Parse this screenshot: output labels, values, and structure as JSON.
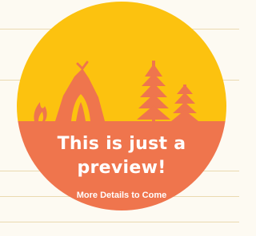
{
  "badge": {
    "title": "This is just a preview!",
    "subtitle": "More Details to Come",
    "icons": [
      "campfire-icon",
      "tent-icon",
      "pine-tree-icon"
    ]
  },
  "colors": {
    "background": "#fdfaf2",
    "stripe": "#ead9b0",
    "sky": "#fcc20f",
    "ground": "#ef754d",
    "text": "#ffffff"
  }
}
